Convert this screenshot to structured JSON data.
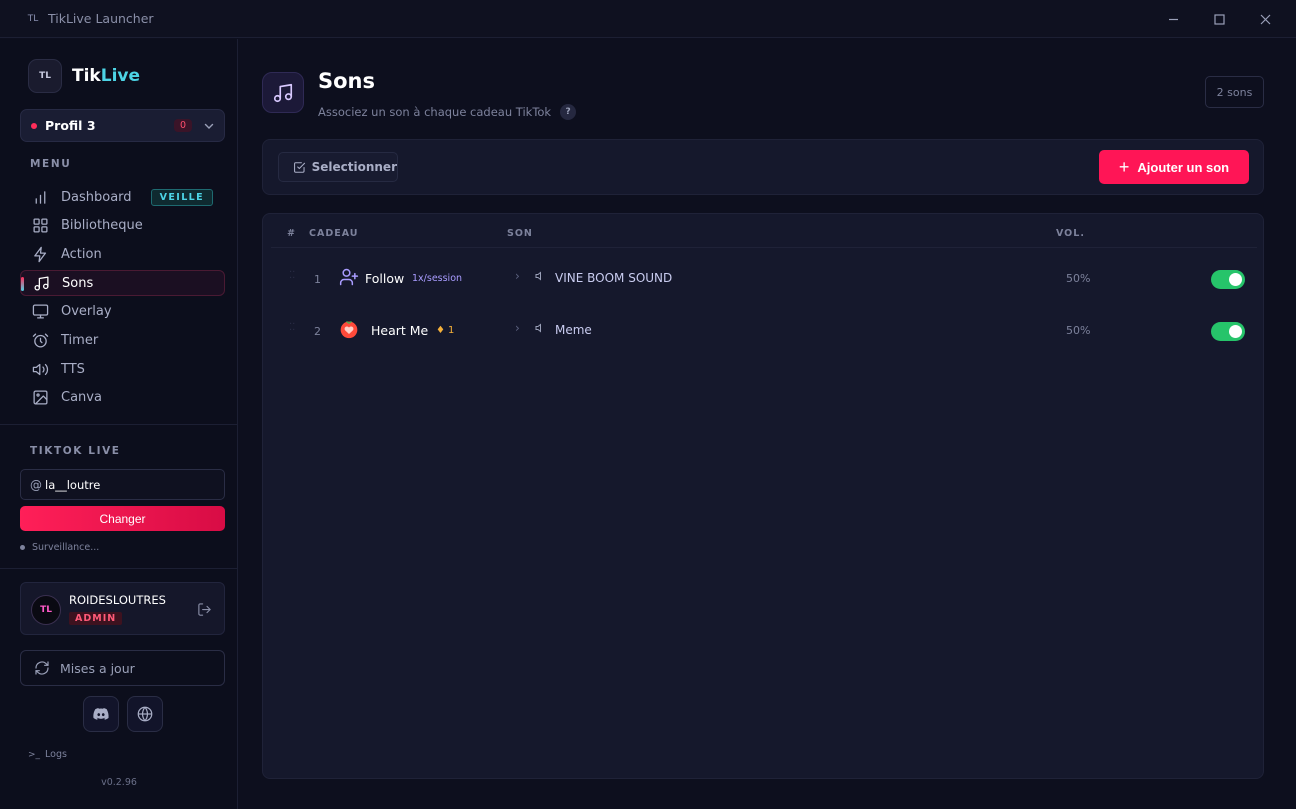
{
  "window": {
    "logo": "TL",
    "title": "TikLive Launcher"
  },
  "brand": {
    "logo": "TL",
    "name_part1": "Tik",
    "name_part2": "Live"
  },
  "profile": {
    "name": "Profil 3",
    "count": "0"
  },
  "menu": {
    "label": "MENU",
    "items": [
      {
        "label": "Dashboard",
        "icon": "bar-chart-icon",
        "badge": "VEILLE"
      },
      {
        "label": "Bibliotheque",
        "icon": "grid-icon"
      },
      {
        "label": "Action",
        "icon": "lightning-icon"
      },
      {
        "label": "Sons",
        "icon": "music-note-icon",
        "active": true
      },
      {
        "label": "Overlay",
        "icon": "monitor-icon"
      },
      {
        "label": "Timer",
        "icon": "alarm-clock-icon"
      },
      {
        "label": "TTS",
        "icon": "speaker-icon"
      },
      {
        "label": "Canva",
        "icon": "image-icon"
      }
    ]
  },
  "tiktok_live": {
    "label": "TIKTOK LIVE",
    "at": "@",
    "username": "la__loutre",
    "change_button": "Changer",
    "status": "Surveillance..."
  },
  "user": {
    "avatar": "TL",
    "name": "ROIDESLOUTRES",
    "role": "ADMIN"
  },
  "updates_button": "Mises a jour",
  "logs": "Logs",
  "version": "v0.2.96",
  "page": {
    "title": "Sons",
    "subtitle": "Associez un son à chaque cadeau TikTok",
    "help": "?",
    "count": "2 sons"
  },
  "toolbar": {
    "select_button": "Selectionner",
    "add_button": "Ajouter un son",
    "add_plus": "+"
  },
  "table": {
    "headers": {
      "num": "#",
      "gift": "CADEAU",
      "sound": "SON",
      "vol": "VOL."
    },
    "rows": [
      {
        "num": "1",
        "gift": "Follow",
        "tag": "1x/session",
        "coin": "",
        "sound": "VINE BOOM SOUND",
        "vol": "50%",
        "enabled": true
      },
      {
        "num": "2",
        "gift": "Heart Me",
        "tag": "",
        "coin": "1",
        "sound": "Meme",
        "vol": "50%",
        "enabled": true
      }
    ]
  },
  "colors": {
    "accent": "#ff1556",
    "cyan": "#4dd4e6",
    "toggle_on": "#26c46a"
  }
}
